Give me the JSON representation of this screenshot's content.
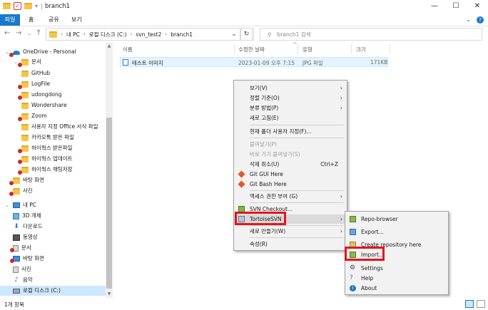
{
  "window": {
    "title": "branch1",
    "minimize": "—",
    "maximize": "☐",
    "close": "✕"
  },
  "ribbon": {
    "tabs": [
      "파일",
      "홈",
      "공유",
      "보기"
    ]
  },
  "address": {
    "crumbs": [
      "내 PC",
      "로컬 디스크 (C:)",
      "svn_test2",
      "branch1"
    ],
    "search_placeholder": "branch1 검색"
  },
  "sidebar": {
    "items": [
      {
        "label": "OneDrive - Personal",
        "icon": "cloud-icon"
      },
      {
        "label": "문서",
        "icon": "folder-icon"
      },
      {
        "label": "GitHub",
        "icon": "folder-icon"
      },
      {
        "label": "LogFile",
        "icon": "folder-icon"
      },
      {
        "label": "udongdong",
        "icon": "folder-icon"
      },
      {
        "label": "Wondershare",
        "icon": "folder-icon"
      },
      {
        "label": "Zoom",
        "icon": "folder-icon"
      },
      {
        "label": "사용자 지정 Office 서식 파일",
        "icon": "folder-icon"
      },
      {
        "label": "카카오톡 받은 파일",
        "icon": "folder-icon"
      },
      {
        "label": "하이웍스 받은파일",
        "icon": "folder-icon"
      },
      {
        "label": "하이웍스 업데이트",
        "icon": "folder-icon"
      },
      {
        "label": "하이웍스 채팅저장",
        "icon": "folder-icon"
      },
      {
        "label": "바탕 화면",
        "icon": "folder-icon"
      },
      {
        "label": "사진",
        "icon": "folder-icon"
      },
      {
        "label": "내 PC",
        "icon": "pc-icon"
      },
      {
        "label": "3D 개체",
        "icon": "cube-icon"
      },
      {
        "label": "다운로드",
        "icon": "download-icon"
      },
      {
        "label": "동영상",
        "icon": "video-icon"
      },
      {
        "label": "문서",
        "icon": "document-icon"
      },
      {
        "label": "바탕 화면",
        "icon": "desktop-icon"
      },
      {
        "label": "사진",
        "icon": "pictures-icon"
      },
      {
        "label": "음악",
        "icon": "music-icon"
      },
      {
        "label": "로컬 디스크 (C:)",
        "icon": "drive-icon"
      }
    ]
  },
  "file_list": {
    "columns": [
      "이름",
      "수정한 날짜",
      "유형",
      "크기"
    ],
    "rows": [
      {
        "name": "테스트 이미지",
        "modified": "2023-01-09 오후 7:15",
        "type": "JPG 파일",
        "size": "171KB"
      }
    ]
  },
  "status": {
    "item_count": "1개 항목"
  },
  "context_menu": {
    "items": [
      {
        "label": "보기(V)",
        "submenu": true
      },
      {
        "label": "정렬 기준(O)",
        "submenu": true
      },
      {
        "label": "분류 방법(P)",
        "submenu": true
      },
      {
        "label": "새로 고침(E)"
      },
      {
        "label": "현재 폴더 사용자 지정(F)..."
      },
      {
        "label": "붙여넣기(P)",
        "disabled": true
      },
      {
        "label": "바로 가기 붙여넣기(S)",
        "disabled": true
      },
      {
        "label": "삭제 취소(U)",
        "shortcut": "Ctrl+Z"
      },
      {
        "label": "Git GUI Here"
      },
      {
        "label": "Git Bash Here"
      },
      {
        "label": "액세스 권한 부여 (G)",
        "submenu": true
      },
      {
        "label": "SVN Checkout..."
      },
      {
        "label": "TortoiseSVN",
        "submenu": true
      },
      {
        "label": "새로 만들기(W)",
        "submenu": true
      },
      {
        "label": "속성(R)"
      }
    ]
  },
  "tortoise_submenu": {
    "items": [
      {
        "label": "Repo-browser"
      },
      {
        "label": "Export..."
      },
      {
        "label": "Create repository here"
      },
      {
        "label": "Import..."
      },
      {
        "label": "Settings"
      },
      {
        "label": "Help"
      },
      {
        "label": "About"
      }
    ]
  },
  "colors": {
    "accent": "#1979ca",
    "highlight_box": "#e8141b"
  }
}
